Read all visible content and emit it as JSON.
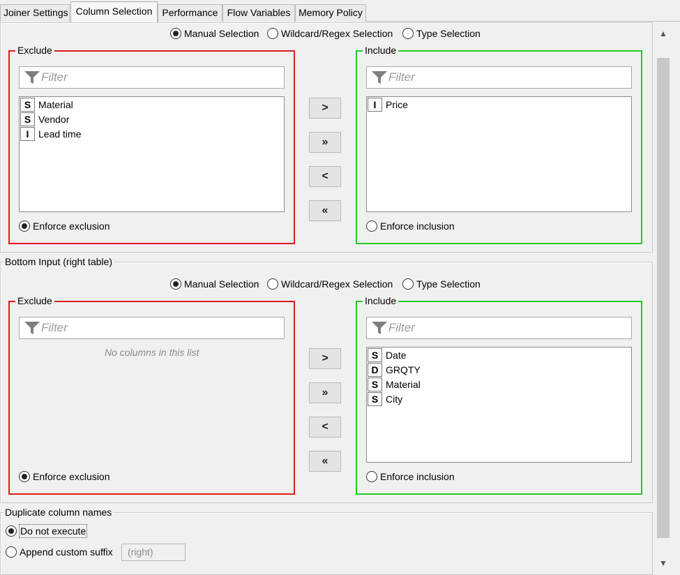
{
  "tabs": [
    "Joiner Settings",
    "Column Selection",
    "Performance",
    "Flow Variables",
    "Memory Policy"
  ],
  "active_tab": "Column Selection",
  "selection_modes": [
    "Manual Selection",
    "Wildcard/Regex Selection",
    "Type Selection"
  ],
  "top_panel": {
    "selected_mode": "Manual Selection",
    "exclude_title": "Exclude",
    "include_title": "Include",
    "filter_placeholder": "Filter",
    "exclude_items": [
      {
        "type": "S",
        "name": "Material"
      },
      {
        "type": "S",
        "name": "Vendor"
      },
      {
        "type": "I",
        "name": "Lead time"
      }
    ],
    "include_items": [
      {
        "type": "I",
        "name": "Price"
      }
    ],
    "enforce_exclusion": "Enforce exclusion",
    "enforce_inclusion": "Enforce inclusion",
    "enforce_selected": "exclusion"
  },
  "bottom_panel": {
    "group_title": "Bottom Input (right table)",
    "selected_mode": "Manual Selection",
    "exclude_title": "Exclude",
    "include_title": "Include",
    "filter_placeholder": "Filter",
    "exclude_empty_text": "No columns in this list",
    "exclude_items": [],
    "include_items": [
      {
        "type": "S",
        "name": "Date"
      },
      {
        "type": "D",
        "name": "GRQTY"
      },
      {
        "type": "S",
        "name": "Material"
      },
      {
        "type": "S",
        "name": "City"
      }
    ],
    "enforce_exclusion": "Enforce exclusion",
    "enforce_inclusion": "Enforce inclusion",
    "enforce_selected": "exclusion"
  },
  "arrow_buttons": {
    "add": ">",
    "add_all": "»",
    "remove": "<",
    "remove_all": "«"
  },
  "duplicates": {
    "group_title": "Duplicate column names",
    "do_not_execute": "Do not execute",
    "append_suffix": "Append custom suffix",
    "suffix_value": "(right)",
    "selected": "do_not_execute"
  },
  "colors": {
    "exclude_border": "#e31b1b",
    "include_border": "#22cc22"
  }
}
